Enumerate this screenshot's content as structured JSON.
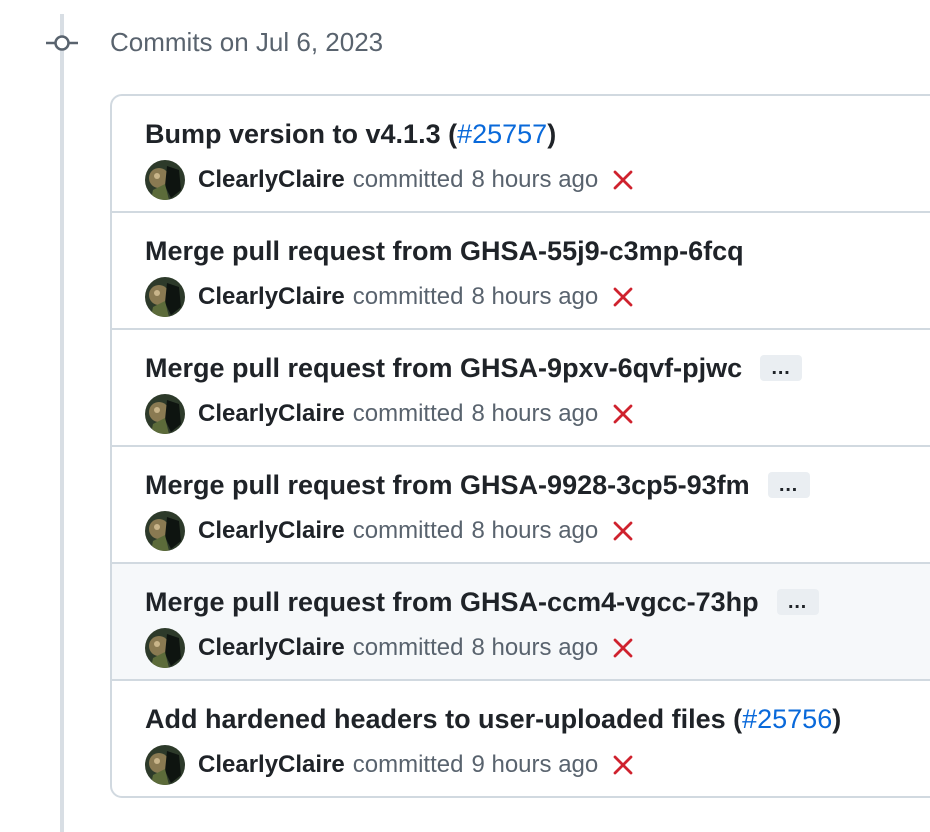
{
  "group": {
    "heading": "Commits on Jul 6, 2023"
  },
  "commits": [
    {
      "title_prefix": "Bump version to v4.1.3 (",
      "pr_link": "#25757",
      "title_suffix": ")",
      "author": "ClearlyClaire",
      "action": "committed",
      "time": "8 hours ago",
      "status": "failure",
      "has_ellipsis": false
    },
    {
      "title_prefix": "Merge pull request from GHSA-55j9-c3mp-6fcq",
      "pr_link": "",
      "title_suffix": "",
      "author": "ClearlyClaire",
      "action": "committed",
      "time": "8 hours ago",
      "status": "failure",
      "has_ellipsis": false
    },
    {
      "title_prefix": "Merge pull request from GHSA-9pxv-6qvf-pjwc",
      "pr_link": "",
      "title_suffix": "",
      "author": "ClearlyClaire",
      "action": "committed",
      "time": "8 hours ago",
      "status": "failure",
      "has_ellipsis": true,
      "ellipsis_label": "…"
    },
    {
      "title_prefix": "Merge pull request from GHSA-9928-3cp5-93fm",
      "pr_link": "",
      "title_suffix": "",
      "author": "ClearlyClaire",
      "action": "committed",
      "time": "8 hours ago",
      "status": "failure",
      "has_ellipsis": true,
      "ellipsis_label": "…"
    },
    {
      "title_prefix": "Merge pull request from GHSA-ccm4-vgcc-73hp",
      "pr_link": "",
      "title_suffix": "",
      "author": "ClearlyClaire",
      "action": "committed",
      "time": "8 hours ago",
      "status": "failure",
      "has_ellipsis": true,
      "ellipsis_label": "…",
      "hovered": true
    },
    {
      "title_prefix": "Add hardened headers to user-uploaded files (",
      "pr_link": "#25756",
      "title_suffix": ")",
      "author": "ClearlyClaire",
      "action": "committed",
      "time": "9 hours ago",
      "status": "failure",
      "has_ellipsis": false
    }
  ],
  "colors": {
    "link": "#0969da",
    "failure": "#cf222e",
    "muted": "#59636e",
    "border": "#d1d9e0"
  }
}
